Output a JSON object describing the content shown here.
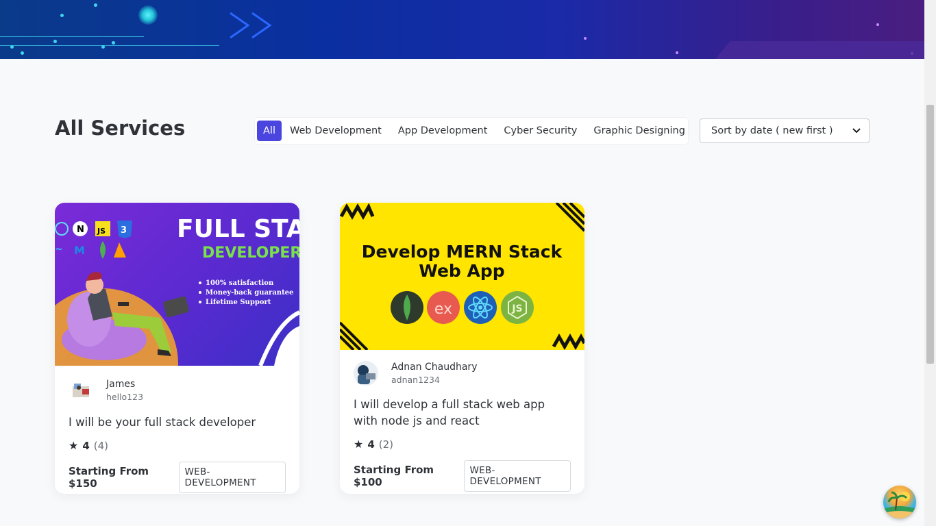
{
  "page": {
    "title": "All Services"
  },
  "filters": [
    {
      "label": "All",
      "active": true
    },
    {
      "label": "Web Development",
      "active": false
    },
    {
      "label": "App Development",
      "active": false
    },
    {
      "label": "Cyber Security",
      "active": false
    },
    {
      "label": "Graphic Designing",
      "active": false
    }
  ],
  "sort": {
    "selected": "Sort by date ( new first )"
  },
  "cards": [
    {
      "image_text": {
        "line1": "FULL STACK",
        "line2": "DEVELOPER",
        "bullets": [
          "100% satisfaction",
          "Money-back guarantee",
          "Lifetime Support"
        ]
      },
      "seller_name": "James",
      "seller_username": "hello123",
      "title": "I will be your full stack developer",
      "rating": "4",
      "rating_count": "(4)",
      "price": "Starting From $150",
      "tag": "WEB-DEVELOPMENT"
    },
    {
      "image_text": {
        "line1": "Develop MERN Stack",
        "line2": "Web App"
      },
      "seller_name": "Adnan Chaudhary",
      "seller_username": "adnan1234",
      "title": "I will develop a full stack web app with node js and react",
      "rating": "4",
      "rating_count": "(2)",
      "price": "Starting From $100",
      "tag": "WEB-DEVELOPMENT"
    }
  ],
  "colors": {
    "accent": "#4b45e0",
    "mern_yellow": "#ffe500",
    "banner_blue": "#0a2fa0"
  }
}
